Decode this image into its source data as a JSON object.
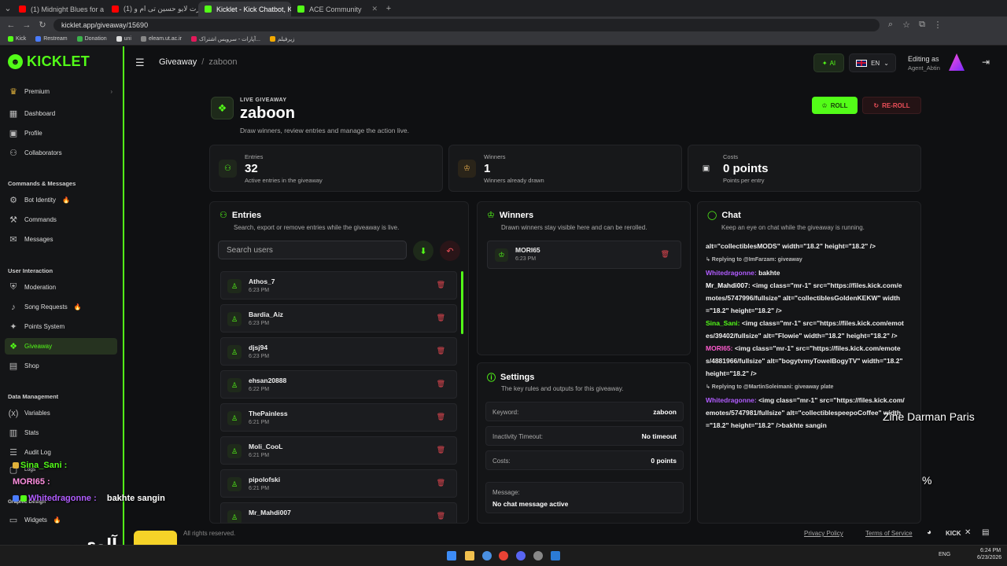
{
  "browser": {
    "tabs": [
      {
        "label": "(1) Midnight Blues for a Br...",
        "color": "#ff0000"
      },
      {
        "label": "(1) از کنسرت لایو حسین تی ام و...",
        "color": "#ff0000"
      },
      {
        "label": "Kicklet - Kick Chatbot, Kick Wi...",
        "color": "#53fc18"
      },
      {
        "label": "ACE Community",
        "color": "#53fc18"
      }
    ],
    "url": "kicklet.app/giveaway/15690",
    "bookmarks": [
      "Kick",
      "Restream",
      "Donation",
      "uni",
      "eleam.ut.ac.ir",
      "آپارات - سرویس اشتراک...",
      "زیرفیلم"
    ]
  },
  "sidebar": {
    "brand": "KICKLET",
    "premium": "Premium",
    "items_top": [
      "Dashboard",
      "Profile",
      "Collaborators"
    ],
    "section_commands": "Commands & Messages",
    "items_commands": [
      "Bot Identity",
      "Commands",
      "Messages"
    ],
    "section_interaction": "User Interaction",
    "items_interaction": [
      "Moderation",
      "Song Requests",
      "Points System",
      "Giveaway",
      "Shop"
    ],
    "section_data": "Data Management",
    "items_data": [
      "Variables",
      "Stats",
      "Audit Log",
      "Logs"
    ],
    "section_graphic": "Graphic Design",
    "items_graphic": [
      "Widgets"
    ]
  },
  "topbar": {
    "crumb_root": "Giveaway",
    "crumb_separator": "/",
    "crumb_current": "zaboon",
    "ai_label": "AI",
    "lang_label": "EN",
    "editing_as": "Editing as",
    "editing_user": "Agent_Abtin"
  },
  "header": {
    "live_label": "LIVE GIVEAWAY",
    "title": "zaboon",
    "subtitle": "Draw winners, review entries and manage the action live.",
    "roll_label": "ROLL",
    "reroll_label": "RE-ROLL"
  },
  "stats": [
    {
      "label": "Entries",
      "value": "32",
      "desc": "Active entries in the giveaway"
    },
    {
      "label": "Winners",
      "value": "1",
      "desc": "Winners already drawn"
    },
    {
      "label": "Costs",
      "value": "0 points",
      "desc": "Points per entry"
    }
  ],
  "entries_panel": {
    "title": "Entries",
    "subtitle": "Search, export or remove entries while the giveaway is live.",
    "search_placeholder": "Search users",
    "rows": [
      {
        "name": "Athos_7",
        "time": "6:23 PM"
      },
      {
        "name": "Bardia_Aiz",
        "time": "6:23 PM"
      },
      {
        "name": "djsj94",
        "time": "6:23 PM"
      },
      {
        "name": "ehsan20888",
        "time": "6:22 PM"
      },
      {
        "name": "ThePainless",
        "time": "6:21 PM"
      },
      {
        "name": "Moli_CooL",
        "time": "6:21 PM"
      },
      {
        "name": "pipolofski",
        "time": "6:21 PM"
      },
      {
        "name": "Mr_Mahdi007",
        "time": ""
      }
    ]
  },
  "winners_panel": {
    "title": "Winners",
    "subtitle": "Drawn winners stay visible here and can be rerolled.",
    "rows": [
      {
        "name": "MORI65",
        "time": "6:23 PM"
      }
    ]
  },
  "settings_panel": {
    "title": "Settings",
    "subtitle": "The key rules and outputs for this giveaway.",
    "keyword_label": "Keyword:",
    "keyword_value": "zaboon",
    "timeout_label": "Inactivity Timeout:",
    "timeout_value": "No timeout",
    "costs_label": "Costs:",
    "costs_value": "0 points",
    "message_label": "Message:",
    "message_value": "No chat message active"
  },
  "chat_panel": {
    "title": "Chat",
    "subtitle": "Keep an eye on chat while the giveaway is running.",
    "lines": [
      {
        "t": "plain",
        "text": "alt=\"collectiblesMODS\" width=\"18.2\" height=\"18.2\" />"
      },
      {
        "t": "reply",
        "text": "↳ Replying to @ImFarzam: giveaway"
      },
      {
        "t": "user",
        "user": "Whitedragonne:",
        "cls": "u-purple",
        "text": "bakhte"
      },
      {
        "t": "user",
        "user": "Mr_Mahdi007:",
        "cls": "u-white",
        "text": "<img class=\"mr-1\" src=\"https://files.kick.com/emotes/5747996/fullsize\" alt=\"collectiblesGoldenKEKW\" width=\"18.2\" height=\"18.2\" />"
      },
      {
        "t": "user",
        "user": "Sina_Sani:",
        "cls": "u-green",
        "text": "<img class=\"mr-1\" src=\"https://files.kick.com/emotes/39402/fullsize\" alt=\"Flowie\" width=\"18.2\" height=\"18.2\" />"
      },
      {
        "t": "user",
        "user": "MORI65:",
        "cls": "u-pink",
        "text": "<img class=\"mr-1\" src=\"https://files.kick.com/emotes/4881966/fullsize\" alt=\"bogytvmyTowelBogyTV\" width=\"18.2\" height=\"18.2\" />"
      },
      {
        "t": "reply",
        "text": "↳ Replying to @MartinSoleimani: giveaway plate"
      },
      {
        "t": "user",
        "user": "Whitedragonne:",
        "cls": "u-purple",
        "text": "<img class=\"mr-1\" src=\"https://files.kick.com/emotes/5747981/fullsize\" alt=\"collectiblespeepoCoffee\" width=\"18.2\" height=\"18.2\" />bakhte sangin"
      }
    ]
  },
  "footer": {
    "copyright": "All rights reserved.",
    "privacy": "Privacy Policy",
    "terms": "Terms of Service",
    "kick": "KICK"
  },
  "stream_overlay": {
    "chat_lines": [
      {
        "user": "Sina_Sani :",
        "text": ""
      },
      {
        "user": "MORI65 :",
        "text": ""
      },
      {
        "user": "Whitedragonne :",
        "text": "bakhte sangin"
      }
    ],
    "sponsor_logo": "آلوی‌پی",
    "right_text": "Zine Darman Paris",
    "percent": "%"
  },
  "taskbar": {
    "lang": "ENG",
    "time": "6:24 PM",
    "date": "6/23/2026"
  },
  "colors": {
    "accent": "#53fc18",
    "danger": "#f0505a",
    "bg": "#0f1012"
  }
}
